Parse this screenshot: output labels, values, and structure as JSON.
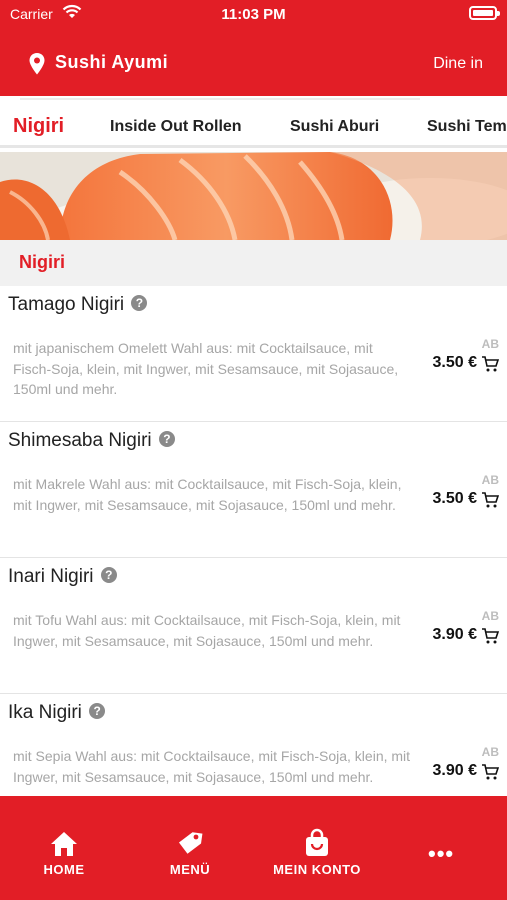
{
  "status_bar": {
    "carrier": "Carrier",
    "time": "11:03 PM"
  },
  "header": {
    "restaurant_name": "Sushi Ayumi",
    "mode": "Dine in",
    "location_icon": "map-pin-icon"
  },
  "tabs": [
    {
      "label": "Nigiri",
      "active": true
    },
    {
      "label": "Inside Out Rollen",
      "active": false
    },
    {
      "label": "Sushi Aburi",
      "active": false
    },
    {
      "label": "Sushi Tem",
      "active": false
    }
  ],
  "section": {
    "title": "Nigiri"
  },
  "items": [
    {
      "name": "Tamago Nigiri",
      "description": "mit japanischem Omelett Wahl aus: mit Cocktailsauce, mit Fisch-Soja, klein, mit Ingwer, mit Sesamsauce, mit Sojasauce, 150ml und mehr.",
      "price_prefix": "AB",
      "price": "3.50 €"
    },
    {
      "name": "Shimesaba Nigiri",
      "description": "mit Makrele Wahl aus: mit Cocktailsauce, mit Fisch-Soja, klein, mit Ingwer, mit Sesamsauce, mit Sojasauce, 150ml und mehr.",
      "price_prefix": "AB",
      "price": "3.50 €"
    },
    {
      "name": "Inari Nigiri",
      "description": "mit Tofu Wahl aus: mit Cocktailsauce, mit Fisch-Soja, klein, mit Ingwer, mit Sesamsauce, mit Sojasauce, 150ml und mehr.",
      "price_prefix": "AB",
      "price": "3.90 €"
    },
    {
      "name": "Ika Nigiri",
      "description": "mit Sepia Wahl aus: mit Cocktailsauce, mit Fisch-Soja, klein, mit Ingwer, mit Sesamsauce, mit Sojasauce, 150ml und mehr.",
      "price_prefix": "AB",
      "price": "3.90 €"
    }
  ],
  "bottom_nav": {
    "home": "HOME",
    "menu": "MENÜ",
    "account": "MEIN KONTO",
    "more": "•••"
  },
  "colors": {
    "brand_red": "#e21e26",
    "section_bg": "#f1f1f1",
    "desc_gray": "#a6a6a6"
  }
}
